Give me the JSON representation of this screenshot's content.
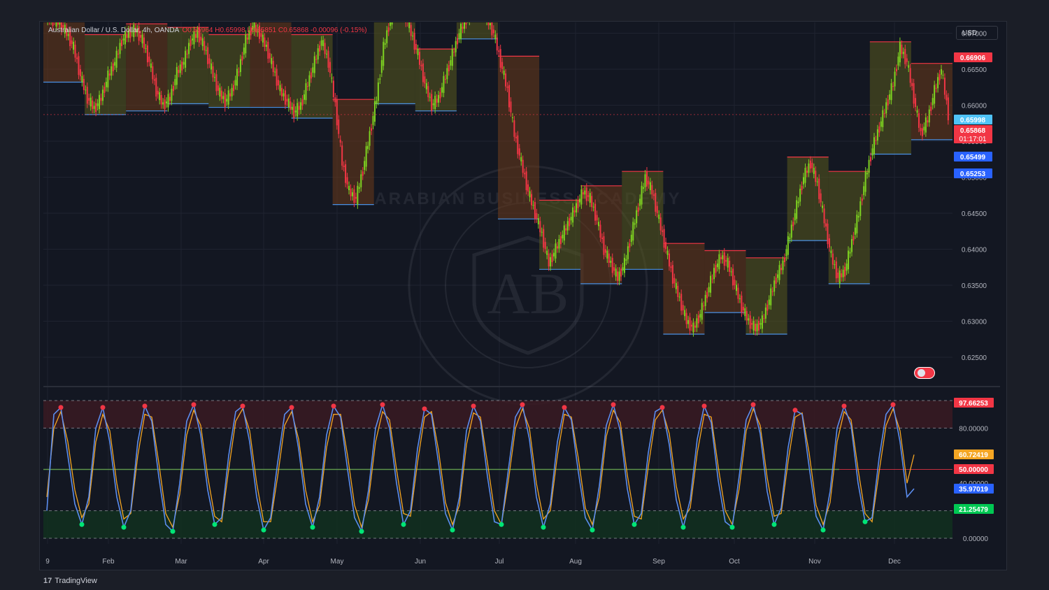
{
  "header": {
    "symbol": "Australian Dollar / U.S. Dollar, 4h, OANDA",
    "ohlc": "O0.65964 H0.65998 L0.65851 C0.65868 -0.00096 (-0.15%)"
  },
  "currency_button": "USD",
  "brand": {
    "logo_mark": "17",
    "name": "TradingView"
  },
  "watermark": {
    "text": "ARABIAN BUSINESS ACADEMY",
    "monogram": "AB"
  },
  "colors": {
    "background": "#131722",
    "grid": "#1f2330",
    "bull": "#26a69a",
    "bull_candle": "#7ed321",
    "bear": "#f23645",
    "blue_line": "#4a90e2",
    "kline": "#5b8def",
    "dline": "#f5a623",
    "overbought": "#f23645",
    "oversold": "#00e676"
  },
  "chart_data": [
    {
      "type": "line",
      "title": "Australian Dollar / U.S. Dollar, 4h, OANDA",
      "x_labels": [
        "9",
        "Feb",
        "Mar",
        "Apr",
        "May",
        "Jun",
        "Jul",
        "Aug",
        "Sep",
        "Oct",
        "Nov",
        "Dec"
      ],
      "y_ticks": [
        "0.67000",
        "0.66500",
        "0.66000",
        "0.65500",
        "0.65000",
        "0.64500",
        "0.64000",
        "0.63500",
        "0.63000",
        "0.62500"
      ],
      "ylim": [
        0.6215,
        0.6715
      ],
      "series": [
        {
          "values": [
            0.6725,
            0.6718,
            0.6715,
            0.67,
            0.668,
            0.664,
            0.661,
            0.6595,
            0.661,
            0.664,
            0.666,
            0.669,
            0.67,
            0.6705,
            0.669,
            0.666,
            0.662,
            0.66,
            0.661,
            0.6645,
            0.666,
            0.669,
            0.67,
            0.668,
            0.665,
            0.662,
            0.6605,
            0.662,
            0.665,
            0.669,
            0.671,
            0.67,
            0.668,
            0.665,
            0.662,
            0.6605,
            0.659,
            0.66,
            0.663,
            0.666,
            0.669,
            0.666,
            0.66,
            0.652,
            0.648,
            0.647,
            0.651,
            0.656,
            0.661,
            0.668,
            0.672,
            0.674,
            0.673,
            0.67,
            0.667,
            0.663,
            0.66,
            0.661,
            0.664,
            0.667,
            0.67,
            0.672,
            0.674,
            0.674,
            0.672,
            0.67,
            0.666,
            0.662,
            0.656,
            0.652,
            0.648,
            0.645,
            0.642,
            0.638,
            0.64,
            0.642,
            0.644,
            0.646,
            0.648,
            0.647,
            0.644,
            0.64,
            0.638,
            0.636,
            0.638,
            0.642,
            0.646,
            0.65,
            0.648,
            0.644,
            0.64,
            0.636,
            0.633,
            0.63,
            0.629,
            0.631,
            0.634,
            0.637,
            0.639,
            0.638,
            0.635,
            0.632,
            0.63,
            0.629,
            0.63,
            0.633,
            0.636,
            0.638,
            0.642,
            0.646,
            0.65,
            0.652,
            0.649,
            0.644,
            0.639,
            0.636,
            0.637,
            0.641,
            0.645,
            0.65,
            0.654,
            0.657,
            0.66,
            0.663,
            0.668,
            0.666,
            0.661,
            0.656,
            0.658,
            0.662,
            0.665,
            0.6587
          ]
        }
      ],
      "price_labels": [
        {
          "value": "0.66906",
          "color": "#f23645"
        },
        {
          "value": "0.65998",
          "color": "#4fc3f7"
        },
        {
          "value": "0.65868",
          "color": "#f23645",
          "sub": "01:17:01"
        },
        {
          "value": "0.65499",
          "color": "#2962ff"
        },
        {
          "value": "0.65253",
          "color": "#2962ff"
        }
      ]
    },
    {
      "type": "line",
      "y_ticks": [
        "80.00000",
        "40.00000",
        "0.00000"
      ],
      "ylim": [
        0,
        100
      ],
      "levels": [
        97.66253,
        80,
        50,
        20,
        0
      ],
      "series": [
        {
          "values": [
            20,
            90,
            95,
            60,
            25,
            10,
            30,
            80,
            95,
            70,
            30,
            8,
            20,
            70,
            96,
            85,
            45,
            10,
            5,
            40,
            85,
            97,
            75,
            35,
            10,
            15,
            60,
            92,
            96,
            70,
            30,
            6,
            15,
            55,
            90,
            95,
            65,
            25,
            8,
            30,
            75,
            96,
            88,
            50,
            15,
            5,
            35,
            80,
            97,
            80,
            40,
            10,
            20,
            65,
            94,
            90,
            55,
            18,
            6,
            30,
            78,
            96,
            85,
            45,
            12,
            10,
            50,
            88,
            97,
            72,
            30,
            8,
            25,
            70,
            95,
            86,
            48,
            15,
            6,
            38,
            82,
            97,
            78,
            36,
            10,
            18,
            62,
            92,
            95,
            68,
            28,
            8,
            28,
            72,
            96,
            84,
            42,
            12,
            8,
            45,
            86,
            97,
            76,
            34,
            10,
            22,
            66,
            93,
            90,
            52,
            16,
            6,
            34,
            80,
            96,
            82,
            40,
            12,
            15,
            58,
            90,
            97,
            70,
            30,
            36
          ]
        },
        {
          "values": [
            30,
            80,
            92,
            70,
            35,
            15,
            25,
            70,
            90,
            78,
            40,
            14,
            18,
            60,
            90,
            88,
            55,
            18,
            8,
            32,
            75,
            93,
            82,
            45,
            16,
            12,
            50,
            85,
            94,
            78,
            40,
            12,
            12,
            45,
            82,
            92,
            72,
            35,
            12,
            24,
            66,
            90,
            90,
            60,
            24,
            8,
            28,
            70,
            92,
            86,
            50,
            18,
            16,
            55,
            88,
            92,
            64,
            26,
            10,
            24,
            68,
            91,
            88,
            55,
            20,
            10,
            42,
            80,
            94,
            80,
            40,
            14,
            20,
            60,
            90,
            88,
            58,
            22,
            10,
            30,
            74,
            93,
            84,
            46,
            16,
            14,
            52,
            86,
            93,
            76,
            38,
            14,
            22,
            62,
            90,
            88,
            52,
            20,
            10,
            36,
            78,
            94,
            82,
            44,
            16,
            18,
            56,
            88,
            91,
            62,
            24,
            10,
            26,
            70,
            92,
            86,
            50,
            18,
            12,
            48,
            82,
            94,
            78,
            40,
            60.7
          ]
        }
      ],
      "value_labels": [
        {
          "value": "97.66253",
          "color": "#f23645"
        },
        {
          "value": "60.72419",
          "color": "#f5a623"
        },
        {
          "value": "50.00000",
          "color": "#f23645"
        },
        {
          "value": "35.97019",
          "color": "#2962ff"
        },
        {
          "value": "21.25479",
          "color": "#00c853"
        }
      ]
    }
  ]
}
